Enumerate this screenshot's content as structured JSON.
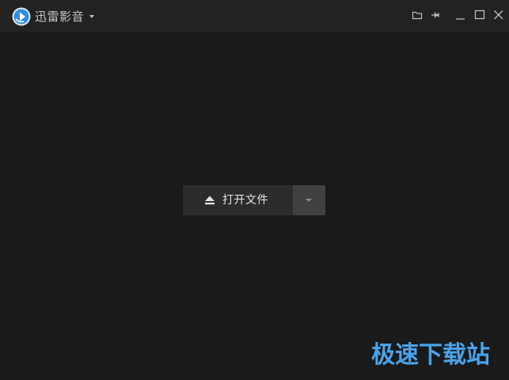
{
  "titlebar": {
    "app_name": "迅雷影音",
    "icons": [
      "app-logo-icon",
      "caret-down-icon",
      "folder-icon",
      "pin-icon",
      "minimize-icon",
      "maximize-icon",
      "close-icon"
    ]
  },
  "main": {
    "open_button_label": "打开文件",
    "open_button_icon": "eject-icon",
    "dropdown_icon": "caret-down-icon"
  },
  "watermark": {
    "text": "极速下载站"
  },
  "colors": {
    "background": "#1a1a1a",
    "titlebar": "#222222",
    "button": "#2c2c2c",
    "dropdown": "#414141",
    "watermark": "#4aa3ea",
    "logo": "#2f8fdf"
  }
}
